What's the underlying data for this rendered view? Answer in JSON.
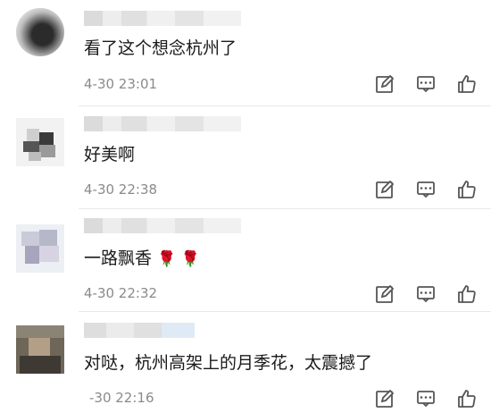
{
  "comments": [
    {
      "text": "看了这个想念杭州了",
      "time": "4-30 23:01"
    },
    {
      "text": "好美啊",
      "time": "4-30 22:38"
    },
    {
      "text": "一路飘香",
      "emoji": "🌹 🌹",
      "time": "4-30 22:32"
    },
    {
      "text": "对哒，杭州高架上的月季花，太震撼了",
      "time": "-30 22:16"
    }
  ],
  "icons": {
    "reply": "edit-icon",
    "message": "comment-icon",
    "like": "thumbs-up-icon"
  },
  "colors": {
    "text": "#1a1a1a",
    "time": "#8a8a8a",
    "icon": "#555555"
  }
}
